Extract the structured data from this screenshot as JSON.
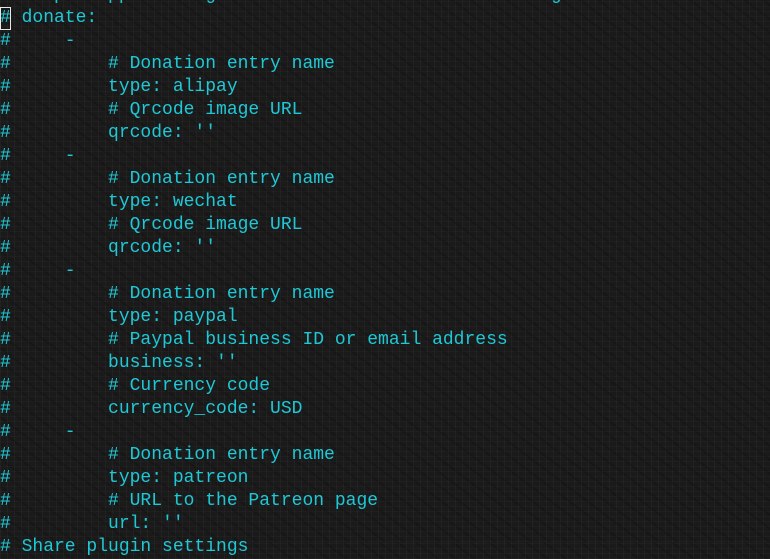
{
  "editor": {
    "lines": [
      {
        "comment": "#",
        "text": " https://ppoffice.github.io/hexo-theme-icarus/categories/Donation/"
      },
      {
        "comment": "#",
        "text": " donate:",
        "cursor": true
      },
      {
        "comment": "#",
        "text": "     -"
      },
      {
        "comment": "#",
        "text": "         # Donation entry name"
      },
      {
        "comment": "#",
        "text": "         type: alipay"
      },
      {
        "comment": "#",
        "text": "         # Qrcode image URL"
      },
      {
        "comment": "#",
        "text": "         qrcode: ''"
      },
      {
        "comment": "#",
        "text": "     -"
      },
      {
        "comment": "#",
        "text": "         # Donation entry name"
      },
      {
        "comment": "#",
        "text": "         type: wechat"
      },
      {
        "comment": "#",
        "text": "         # Qrcode image URL"
      },
      {
        "comment": "#",
        "text": "         qrcode: ''"
      },
      {
        "comment": "#",
        "text": "     -"
      },
      {
        "comment": "#",
        "text": "         # Donation entry name"
      },
      {
        "comment": "#",
        "text": "         type: paypal"
      },
      {
        "comment": "#",
        "text": "         # Paypal business ID or email address"
      },
      {
        "comment": "#",
        "text": "         business: ''"
      },
      {
        "comment": "#",
        "text": "         # Currency code"
      },
      {
        "comment": "#",
        "text": "         currency_code: USD"
      },
      {
        "comment": "#",
        "text": "     -"
      },
      {
        "comment": "#",
        "text": "         # Donation entry name"
      },
      {
        "comment": "#",
        "text": "         type: patreon"
      },
      {
        "comment": "#",
        "text": "         # URL to the Patreon page"
      },
      {
        "comment": "#",
        "text": "         url: ''"
      },
      {
        "comment": "#",
        "text": " Share plugin settings"
      }
    ]
  },
  "colors": {
    "text": "#1fc8d6",
    "cursor": "#e8e8e8"
  }
}
